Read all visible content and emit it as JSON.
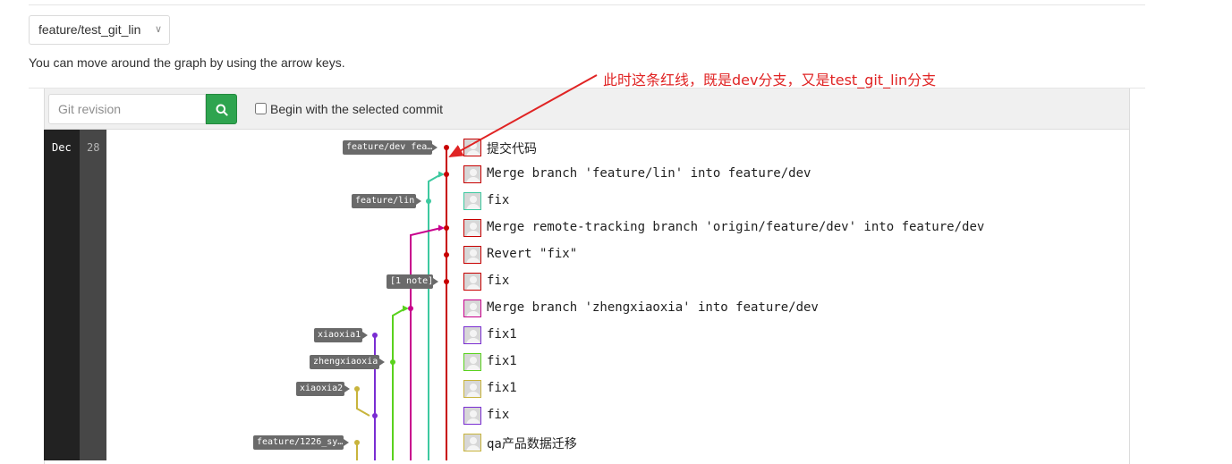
{
  "branch_selector": {
    "value": "feature/test_git_lin"
  },
  "hint": "You can move around the graph by using the arrow keys.",
  "toolbar": {
    "revision_placeholder": "Git revision",
    "begin_label": "Begin with the selected commit"
  },
  "date": {
    "month": "Dec",
    "day": "28"
  },
  "annotation": "此时这条红线，既是dev分支，又是test_git_lin分支",
  "colors": {
    "red_branch": "#c80000",
    "teal_branch": "#3dc9a0",
    "magenta_branch": "#c8008c",
    "green_branch": "#5ad21e",
    "purple_branch": "#7a2dd2",
    "olive_branch": "#c8b43c",
    "annotation": "#e02424",
    "search_button": "#2ea44f"
  },
  "refs": [
    {
      "label": "feature/dev fea…"
    },
    {
      "label": "feature/lin"
    },
    {
      "label": "[1 note]"
    },
    {
      "label": "xiaoxia1"
    },
    {
      "label": "zhengxiaoxia"
    },
    {
      "label": "xiaoxia2"
    },
    {
      "label": "feature/1226_sy…"
    }
  ],
  "commits": [
    {
      "message": "提交代码",
      "avatar_border": "#c80000"
    },
    {
      "message": "Merge branch 'feature/lin' into feature/dev",
      "avatar_border": "#c80000"
    },
    {
      "message": "fix",
      "avatar_border": "#3dc9a0"
    },
    {
      "message": "Merge remote-tracking branch 'origin/feature/dev' into feature/dev",
      "avatar_border": "#c80000"
    },
    {
      "message": "Revert \"fix\"",
      "avatar_border": "#c80000"
    },
    {
      "message": "fix",
      "avatar_border": "#c80000"
    },
    {
      "message": "Merge branch 'zhengxiaoxia' into feature/dev",
      "avatar_border": "#c8008c"
    },
    {
      "message": "fix1",
      "avatar_border": "#7a2dd2"
    },
    {
      "message": "fix1",
      "avatar_border": "#5ad21e"
    },
    {
      "message": "fix1",
      "avatar_border": "#c8b43c"
    },
    {
      "message": "fix",
      "avatar_border": "#7a2dd2"
    },
    {
      "message": "qa产品数据迁移",
      "avatar_border": "#c8b43c"
    }
  ]
}
